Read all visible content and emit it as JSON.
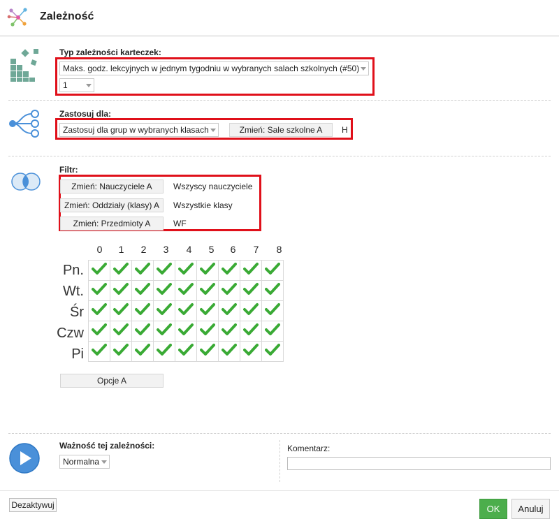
{
  "header": {
    "title": "Zależność"
  },
  "type_section": {
    "label": "Typ zależności karteczek:",
    "type_select": "Maks. godz. lekcyjnych w jednym tygodniu w wybranych salach szkolnych (#50)",
    "count_select": "1"
  },
  "apply_section": {
    "label": "Zastosuj dla:",
    "apply_select": "Zastosuj dla grup w wybranych klasach",
    "change_rooms_button": "Zmień: Sale szkolne A",
    "rooms_value": "H"
  },
  "filter_section": {
    "label": "Filtr:",
    "rows": [
      {
        "button": "Zmień: Nauczyciele A",
        "value": "Wszyscy nauczyciele"
      },
      {
        "button": "Zmień: Oddziały (klasy) A",
        "value": "Wszystkie klasy"
      },
      {
        "button": "Zmień: Przedmioty A",
        "value": "WF"
      }
    ]
  },
  "timetable": {
    "periods": [
      "0",
      "1",
      "2",
      "3",
      "4",
      "5",
      "6",
      "7",
      "8"
    ],
    "days": [
      "Pn.",
      "Wt.",
      "Śr",
      "Czw",
      "Pi"
    ],
    "all_checked": true,
    "check_color": "#3aaa35",
    "options_button": "Opcje A"
  },
  "importance_section": {
    "label": "Ważność tej zależności:",
    "importance_select": "Normalna"
  },
  "comment_section": {
    "label": "Komentarz:",
    "value": ""
  },
  "footer": {
    "deactivate_button": "Dezaktywuj",
    "ok_button": "OK",
    "cancel_button": "Anuluj"
  },
  "colors": {
    "accent_red": "#e0101a",
    "ok_green": "#4cae4c",
    "play_blue": "#4a90d9"
  }
}
